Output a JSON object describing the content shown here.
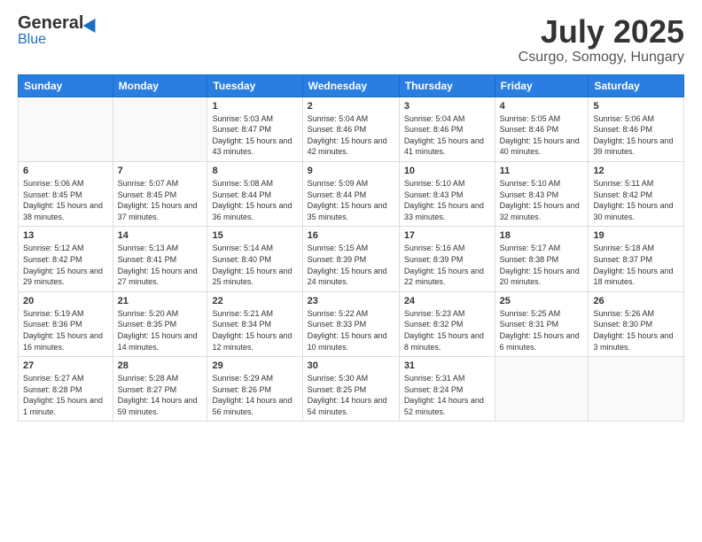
{
  "header": {
    "logo_general": "General",
    "logo_blue": "Blue",
    "title": "July 2025",
    "subtitle": "Csurgo, Somogy, Hungary"
  },
  "days_of_week": [
    "Sunday",
    "Monday",
    "Tuesday",
    "Wednesday",
    "Thursday",
    "Friday",
    "Saturday"
  ],
  "weeks": [
    [
      {
        "day": "",
        "info": ""
      },
      {
        "day": "",
        "info": ""
      },
      {
        "day": "1",
        "info": "Sunrise: 5:03 AM\nSunset: 8:47 PM\nDaylight: 15 hours and 43 minutes."
      },
      {
        "day": "2",
        "info": "Sunrise: 5:04 AM\nSunset: 8:46 PM\nDaylight: 15 hours and 42 minutes."
      },
      {
        "day": "3",
        "info": "Sunrise: 5:04 AM\nSunset: 8:46 PM\nDaylight: 15 hours and 41 minutes."
      },
      {
        "day": "4",
        "info": "Sunrise: 5:05 AM\nSunset: 8:46 PM\nDaylight: 15 hours and 40 minutes."
      },
      {
        "day": "5",
        "info": "Sunrise: 5:06 AM\nSunset: 8:46 PM\nDaylight: 15 hours and 39 minutes."
      }
    ],
    [
      {
        "day": "6",
        "info": "Sunrise: 5:06 AM\nSunset: 8:45 PM\nDaylight: 15 hours and 38 minutes."
      },
      {
        "day": "7",
        "info": "Sunrise: 5:07 AM\nSunset: 8:45 PM\nDaylight: 15 hours and 37 minutes."
      },
      {
        "day": "8",
        "info": "Sunrise: 5:08 AM\nSunset: 8:44 PM\nDaylight: 15 hours and 36 minutes."
      },
      {
        "day": "9",
        "info": "Sunrise: 5:09 AM\nSunset: 8:44 PM\nDaylight: 15 hours and 35 minutes."
      },
      {
        "day": "10",
        "info": "Sunrise: 5:10 AM\nSunset: 8:43 PM\nDaylight: 15 hours and 33 minutes."
      },
      {
        "day": "11",
        "info": "Sunrise: 5:10 AM\nSunset: 8:43 PM\nDaylight: 15 hours and 32 minutes."
      },
      {
        "day": "12",
        "info": "Sunrise: 5:11 AM\nSunset: 8:42 PM\nDaylight: 15 hours and 30 minutes."
      }
    ],
    [
      {
        "day": "13",
        "info": "Sunrise: 5:12 AM\nSunset: 8:42 PM\nDaylight: 15 hours and 29 minutes."
      },
      {
        "day": "14",
        "info": "Sunrise: 5:13 AM\nSunset: 8:41 PM\nDaylight: 15 hours and 27 minutes."
      },
      {
        "day": "15",
        "info": "Sunrise: 5:14 AM\nSunset: 8:40 PM\nDaylight: 15 hours and 25 minutes."
      },
      {
        "day": "16",
        "info": "Sunrise: 5:15 AM\nSunset: 8:39 PM\nDaylight: 15 hours and 24 minutes."
      },
      {
        "day": "17",
        "info": "Sunrise: 5:16 AM\nSunset: 8:39 PM\nDaylight: 15 hours and 22 minutes."
      },
      {
        "day": "18",
        "info": "Sunrise: 5:17 AM\nSunset: 8:38 PM\nDaylight: 15 hours and 20 minutes."
      },
      {
        "day": "19",
        "info": "Sunrise: 5:18 AM\nSunset: 8:37 PM\nDaylight: 15 hours and 18 minutes."
      }
    ],
    [
      {
        "day": "20",
        "info": "Sunrise: 5:19 AM\nSunset: 8:36 PM\nDaylight: 15 hours and 16 minutes."
      },
      {
        "day": "21",
        "info": "Sunrise: 5:20 AM\nSunset: 8:35 PM\nDaylight: 15 hours and 14 minutes."
      },
      {
        "day": "22",
        "info": "Sunrise: 5:21 AM\nSunset: 8:34 PM\nDaylight: 15 hours and 12 minutes."
      },
      {
        "day": "23",
        "info": "Sunrise: 5:22 AM\nSunset: 8:33 PM\nDaylight: 15 hours and 10 minutes."
      },
      {
        "day": "24",
        "info": "Sunrise: 5:23 AM\nSunset: 8:32 PM\nDaylight: 15 hours and 8 minutes."
      },
      {
        "day": "25",
        "info": "Sunrise: 5:25 AM\nSunset: 8:31 PM\nDaylight: 15 hours and 6 minutes."
      },
      {
        "day": "26",
        "info": "Sunrise: 5:26 AM\nSunset: 8:30 PM\nDaylight: 15 hours and 3 minutes."
      }
    ],
    [
      {
        "day": "27",
        "info": "Sunrise: 5:27 AM\nSunset: 8:28 PM\nDaylight: 15 hours and 1 minute."
      },
      {
        "day": "28",
        "info": "Sunrise: 5:28 AM\nSunset: 8:27 PM\nDaylight: 14 hours and 59 minutes."
      },
      {
        "day": "29",
        "info": "Sunrise: 5:29 AM\nSunset: 8:26 PM\nDaylight: 14 hours and 56 minutes."
      },
      {
        "day": "30",
        "info": "Sunrise: 5:30 AM\nSunset: 8:25 PM\nDaylight: 14 hours and 54 minutes."
      },
      {
        "day": "31",
        "info": "Sunrise: 5:31 AM\nSunset: 8:24 PM\nDaylight: 14 hours and 52 minutes."
      },
      {
        "day": "",
        "info": ""
      },
      {
        "day": "",
        "info": ""
      }
    ]
  ]
}
